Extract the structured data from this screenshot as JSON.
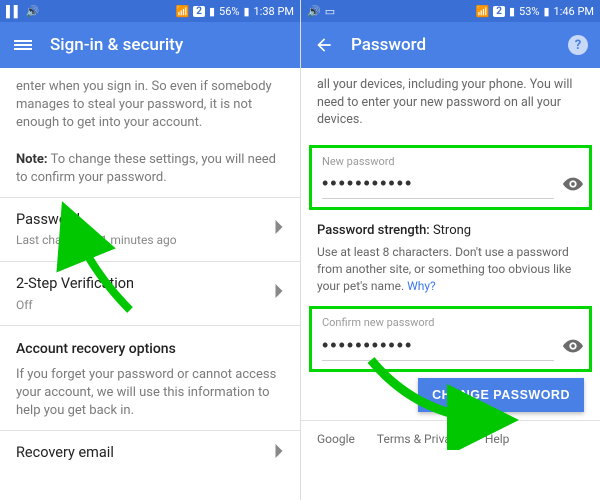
{
  "left": {
    "status": {
      "sim": "2",
      "battery": "56%",
      "time": "1:38 PM"
    },
    "appbar": {
      "title": "Sign-in & security"
    },
    "intro_fragment": "enter when you sign in. So even if somebody manages to steal your password, it is not enough to get into your account.",
    "note_label": "Note:",
    "note_text": " To change these settings, you will need to confirm your password.",
    "items": [
      {
        "title": "Password",
        "sub": "Last changed: 21 minutes ago"
      },
      {
        "title": "2-Step Verification",
        "sub": "Off"
      }
    ],
    "account_recovery_title": "Account recovery options",
    "account_recovery_body": "If you forget your password or cannot access your account, we will use this information to help you get back in.",
    "recovery_email_title": "Recovery email"
  },
  "right": {
    "status": {
      "sim": "2",
      "battery": "53%",
      "time": "1:46 PM"
    },
    "appbar": {
      "title": "Password"
    },
    "intro": "all your devices, including your phone. You will need to enter your new password on all your devices.",
    "fields": {
      "new_label": "New password",
      "new_value": "•••••••••••",
      "confirm_label": "Confirm new password",
      "confirm_value": "•••••••••••"
    },
    "strength_label": "Password strength:",
    "strength_value": " Strong",
    "tips": "Use at least 8 characters. Don't use a password from another site, or something too obvious like your pet's name. ",
    "tips_link": "Why?",
    "change_button": "CHANGE PASSWORD",
    "footer": {
      "google": "Google",
      "terms": "Terms & Privacy",
      "help": "Help"
    }
  }
}
